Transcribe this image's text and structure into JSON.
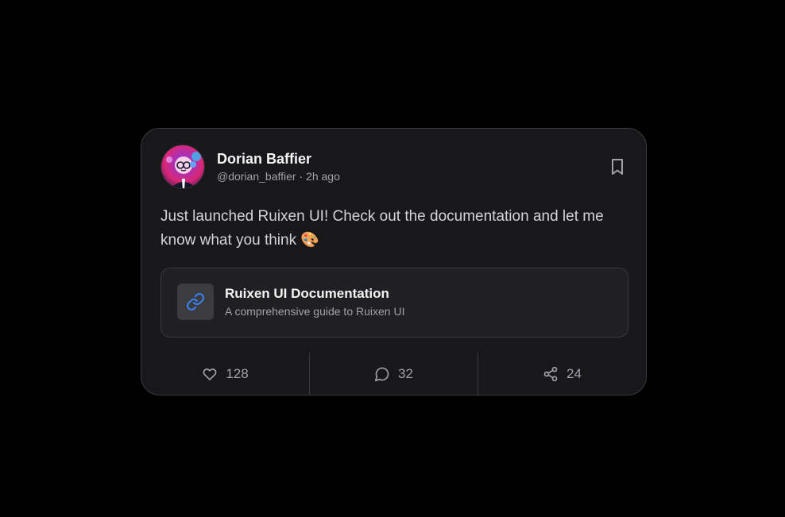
{
  "post": {
    "author": {
      "name": "Dorian Baffier",
      "handle": "@dorian_baffier",
      "separator": "·",
      "time": "2h ago",
      "meta": "@dorian_baffier · 2h ago"
    },
    "text": "Just launched Ruixen UI! Check out the documentation and let me know what you think 🎨",
    "link": {
      "title": "Ruixen UI Documentation",
      "description": "A comprehensive guide to Ruixen UI",
      "icon": "link-icon"
    },
    "actions": {
      "likes": "128",
      "comments": "32",
      "shares": "24"
    }
  },
  "colors": {
    "background": "#000000",
    "card": "#18181b",
    "border": "#3a3a3f",
    "link_accent": "#3b82f6",
    "muted_text": "#a1a1aa"
  },
  "icons": {
    "bookmark": "bookmark-icon",
    "like": "heart-icon",
    "comment": "comment-icon",
    "share": "share-icon"
  }
}
